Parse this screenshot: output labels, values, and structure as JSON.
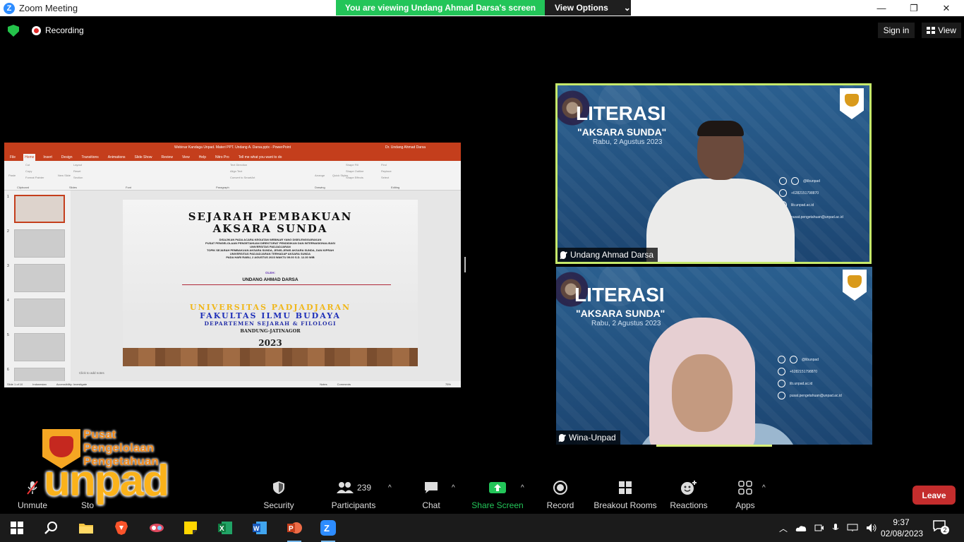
{
  "window": {
    "title": "Zoom Meeting",
    "minimize": "—",
    "maximize": "❐",
    "close": "✕"
  },
  "share_banner": {
    "message": "You are viewing Undang Ahmad Darsa's screen",
    "options_label": "View Options",
    "options_caret": "⌄"
  },
  "meeting_bar": {
    "recording_label": "Recording",
    "signin_label": "Sign in",
    "view_label": "View"
  },
  "powerpoint": {
    "title": "Webinar Kandaga Unpad. Materi PPT. Undang A. Darsa.pptx  -  PowerPoint",
    "user": "Dr. Undang Ahmad Darsa",
    "tabs": [
      "File",
      "Home",
      "Insert",
      "Design",
      "Transitions",
      "Animations",
      "Slide Show",
      "Review",
      "View",
      "Help",
      "Nitro Pro",
      "Tell me what you want to do"
    ],
    "active_tab": "Home",
    "ribbon_groups": [
      "Clipboard",
      "Slides",
      "Font",
      "Paragraph",
      "Drawing",
      "Editing"
    ],
    "ribbon_items": [
      "Paste",
      "Cut",
      "Copy",
      "Format Painter",
      "New Slide",
      "Layout",
      "Reset",
      "Section",
      "Text Direction",
      "Align Text",
      "Convert to SmartArt",
      "Arrange",
      "Quick Styles",
      "Shape Fill",
      "Shape Outline",
      "Shape Effects",
      "Find",
      "Replace",
      "Select"
    ],
    "thumbnail_numbers": [
      "1",
      "2",
      "3",
      "4",
      "5",
      "6"
    ],
    "slide": {
      "title_line1": "SEJARAH PEMBAKUAN",
      "title_line2": "AKSARA SUNDA",
      "desc1": "DISAJIKAN PADA ACARA KEGIATAN WEBINAR YANG DISELENGGARAKAN",
      "desc2": "PUSAT PENGELOLAAN PENGETAHUAN DIREKTORAT PENDIDIKAN DAN INTERNASIONALISASI",
      "desc3": "UNIVERSITAS PADJADJARAN",
      "desc4": "TOPIK SEJARAH PEMBAKUAN AKSARA SUNDA, JENIS-JENIS AKSARA SUNDA, DAN KIPRAH",
      "desc5": "UNIVERSITAS PADJADJARAN TERHADAP AKSARA SUNDA",
      "desc6": "PADA HARI RABU, 2 AGUSTUS 2023 WAKTU 09.00 S.D. 12.30 WIB",
      "oleh": "OLEH:",
      "presenter": "UNDANG AHMAD DARSA",
      "university": "UNIVERSITAS PADJADJARAN",
      "faculty": "FAKULTAS ILMU BUDAYA",
      "department": "DEPARTEMEN SEJARAH & FILOLOGI",
      "location": "BANDUNG-JATINAGOR",
      "year": "2023"
    },
    "notes_placeholder": "Click to add notes",
    "status": {
      "slide_count": "Slide 1 of 10",
      "language": "Indonesian",
      "accessibility": "Accessibility: Investigate",
      "notes": "Notes",
      "comments": "Comments",
      "zoom": "75%"
    }
  },
  "tiles": [
    {
      "name": "Undang Ahmad Darsa",
      "bg_title": "LITERASI",
      "bg_subtitle": "\"AKSARA SUNDA\"",
      "bg_date": "Rabu, 2 Agustus 2023",
      "social": [
        "@libunpad",
        "+6282151798870",
        "lib.unpad.ac.id",
        "pusat.pengetahuan@unpad.ac.id"
      ]
    },
    {
      "name": "Wina-Unpad",
      "bg_title": "LITERASI",
      "bg_subtitle": "\"AKSARA SUNDA\"",
      "bg_date": "Rabu, 2 Agustus 2023",
      "social": [
        "@libunpad",
        "+6282151798870",
        "lib.unpad.ac.id",
        "pusat.pengetahuan@unpad.ac.id"
      ]
    }
  ],
  "logo": {
    "line1": "Pusat",
    "line2": "Pengelolaan",
    "line3": "Pengetahuan",
    "brand": "unpad"
  },
  "toolbar": {
    "unmute": "Unmute",
    "stop_video": "Sto",
    "security": "Security",
    "participants": "Participants",
    "participants_count": "239",
    "chat": "Chat",
    "share_screen": "Share Screen",
    "record": "Record",
    "breakout": "Breakout Rooms",
    "reactions": "Reactions",
    "apps": "Apps",
    "leave": "Leave",
    "caret": "^"
  },
  "taskbar": {
    "time": "9:37",
    "date": "02/08/2023",
    "notification_count": "2",
    "apps": [
      "start",
      "search",
      "file-explorer",
      "brave",
      "snipping-tool",
      "sticky-notes",
      "excel",
      "word",
      "powerpoint",
      "zoom"
    ]
  },
  "colors": {
    "share_green": "#23c559",
    "leave_red": "#c42d2d",
    "active_speaker": "#c6e96b",
    "ppt_red": "#c43e1c"
  }
}
